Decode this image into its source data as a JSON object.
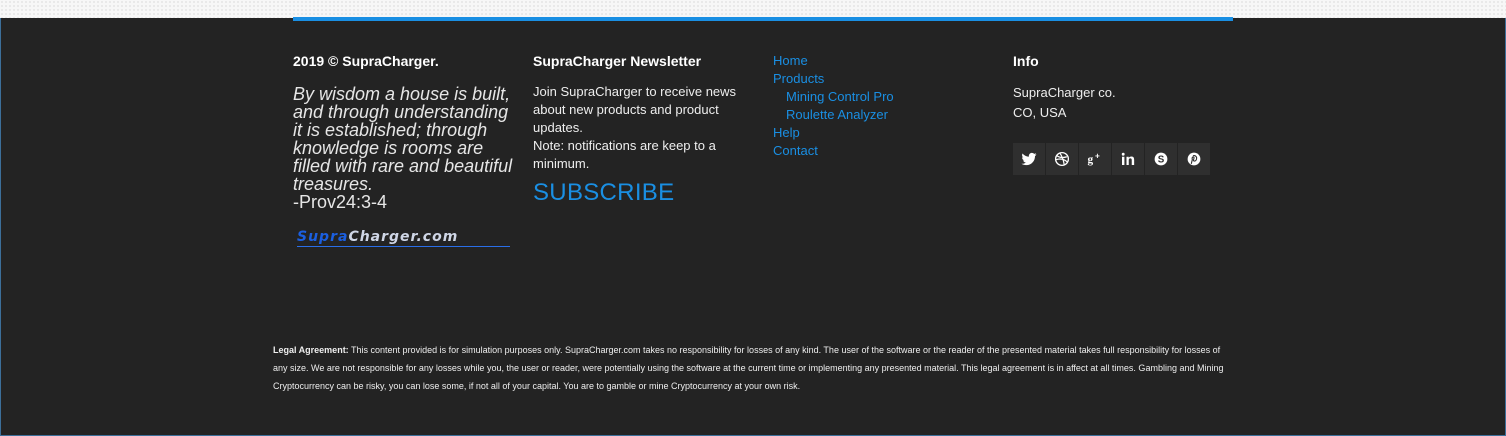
{
  "col1": {
    "copyright": "2019 © SupraCharger.",
    "quote": "By wisdom a house is built, and through understanding it is established; through knowledge is rooms are filled with rare and beautiful treasures.",
    "quote_ref": "-Prov24:3-4",
    "logo_part1": "Supra",
    "logo_part2": "Charger.com"
  },
  "newsletter": {
    "heading": "SupraCharger Newsletter",
    "body": "Join SupraCharger to receive news about new products and product updates.",
    "note": "Note: notifications are keep to a minimum.",
    "subscribe_label": "SUBSCRIBE"
  },
  "nav": {
    "home": "Home",
    "products": "Products",
    "mining": "Mining Control Pro",
    "roulette": "Roulette Analyzer",
    "help": "Help",
    "contact": "Contact"
  },
  "info": {
    "heading": "Info",
    "company": "SupraCharger co.",
    "location": "CO, USA",
    "social_icons": [
      "twitter-icon",
      "dribbble-icon",
      "google-plus-icon",
      "linkedin-icon",
      "skype-icon",
      "pinterest-icon"
    ]
  },
  "legal": {
    "label": "Legal Agreement:",
    "text": "This content provided is for simulation purposes only. SupraCharger.com takes no responsibility for losses of any kind. The user of the software or the reader of the presented material takes full responsibility for losses of any size. We are not responsible for any losses while you, the user or reader, were potentially using the software at the current time or implementing any presented material. This legal agreement is in affect at all times. Gambling and Mining Cryptocurrency can be risky, you can lose some, if not all of your capital. You are to gamble or mine Cryptocurrency at your own risk."
  },
  "colors": {
    "background": "#232323",
    "accent": "#1a8fe3",
    "icon_tile": "#2f2f2f"
  }
}
